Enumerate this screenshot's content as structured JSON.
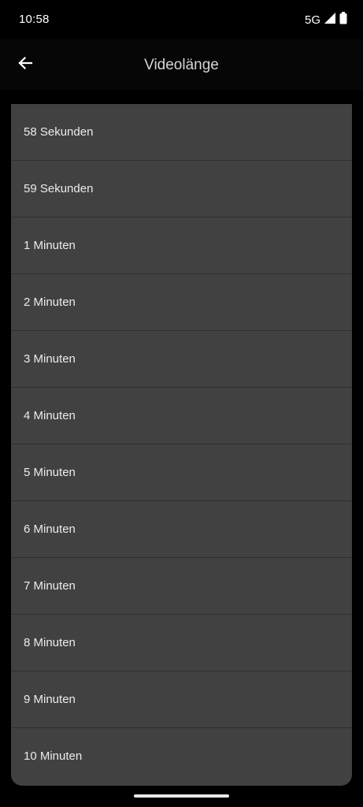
{
  "status_bar": {
    "time": "10:58",
    "network": "5G",
    "icons": [
      "signal-icon",
      "battery-icon"
    ]
  },
  "app_bar": {
    "back_icon": "arrow-left-icon",
    "title": "Videolänge"
  },
  "options": [
    {
      "label": "58 Sekunden"
    },
    {
      "label": "59 Sekunden"
    },
    {
      "label": "1 Minuten"
    },
    {
      "label": "2 Minuten"
    },
    {
      "label": "3 Minuten"
    },
    {
      "label": "4 Minuten"
    },
    {
      "label": "5 Minuten"
    },
    {
      "label": "6 Minuten"
    },
    {
      "label": "7 Minuten"
    },
    {
      "label": "8 Minuten"
    },
    {
      "label": "9 Minuten"
    },
    {
      "label": "10 Minuten"
    }
  ],
  "colors": {
    "background": "#000000",
    "list_background": "#414141",
    "divider": "#2f2f2f",
    "text": "#ececec"
  }
}
